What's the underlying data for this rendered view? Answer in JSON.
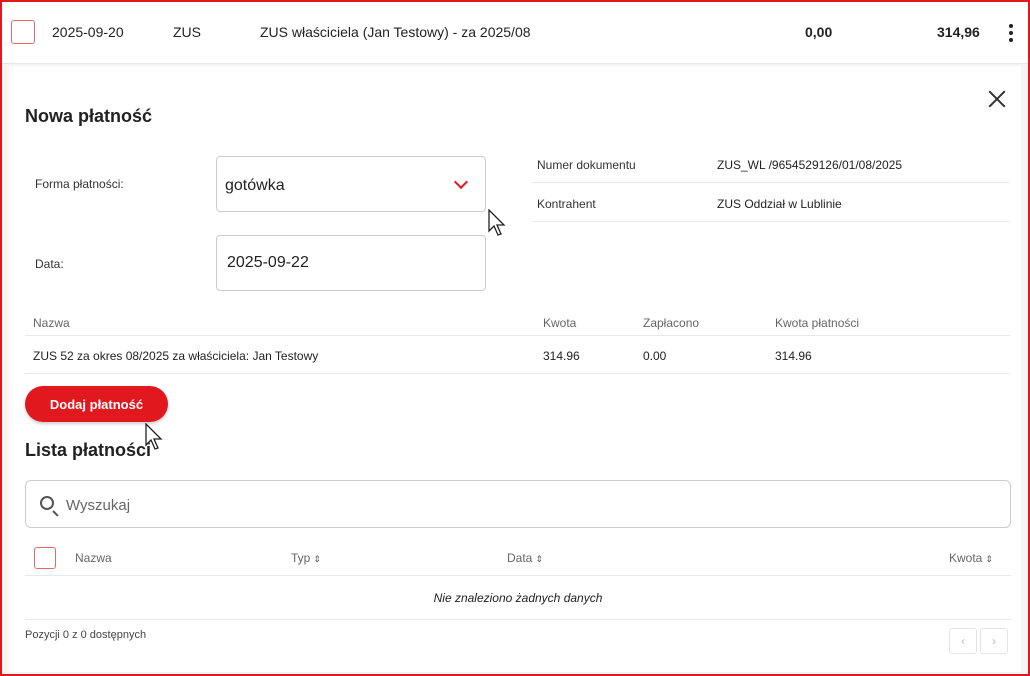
{
  "top_row": {
    "date": "2025-09-20",
    "type": "ZUS",
    "description": "ZUS właściciela (Jan Testowy) - za 2025/08",
    "paid": "0,00",
    "amount": "314,96"
  },
  "panel": {
    "title": "Nowa płatność",
    "form_label": "Forma płatności:",
    "form_value": "gotówka",
    "date_label": "Data:",
    "date_value": "2025-09-22",
    "info": {
      "doc_label": "Numer dokumentu",
      "doc_value": "ZUS_WL /9654529126/01/08/2025",
      "contractor_label": "Kontrahent",
      "contractor_value": "ZUS Oddział w Lublinie"
    },
    "items": {
      "headers": {
        "name": "Nazwa",
        "amount": "Kwota",
        "paid": "Zapłacono",
        "payment": "Kwota płatności"
      },
      "rows": [
        {
          "name": "ZUS 52 za okres 08/2025 za właściciela: Jan Testowy",
          "amount": "314.96",
          "paid": "0.00",
          "payment": "314.96"
        }
      ]
    },
    "add_button": "Dodaj płatność",
    "list_title": "Lista płatności",
    "search_placeholder": "Wyszukaj",
    "list": {
      "headers": {
        "name": "Nazwa",
        "type": "Typ",
        "date": "Data",
        "amount": "Kwota"
      },
      "empty": "Nie znaleziono żadnych danych"
    },
    "pager_info": "Pozycji 0 z 0 dostępnych",
    "pager_prev": "‹",
    "pager_next": "›"
  },
  "colors": {
    "accent": "#e2181f",
    "border": "#cccccc"
  }
}
